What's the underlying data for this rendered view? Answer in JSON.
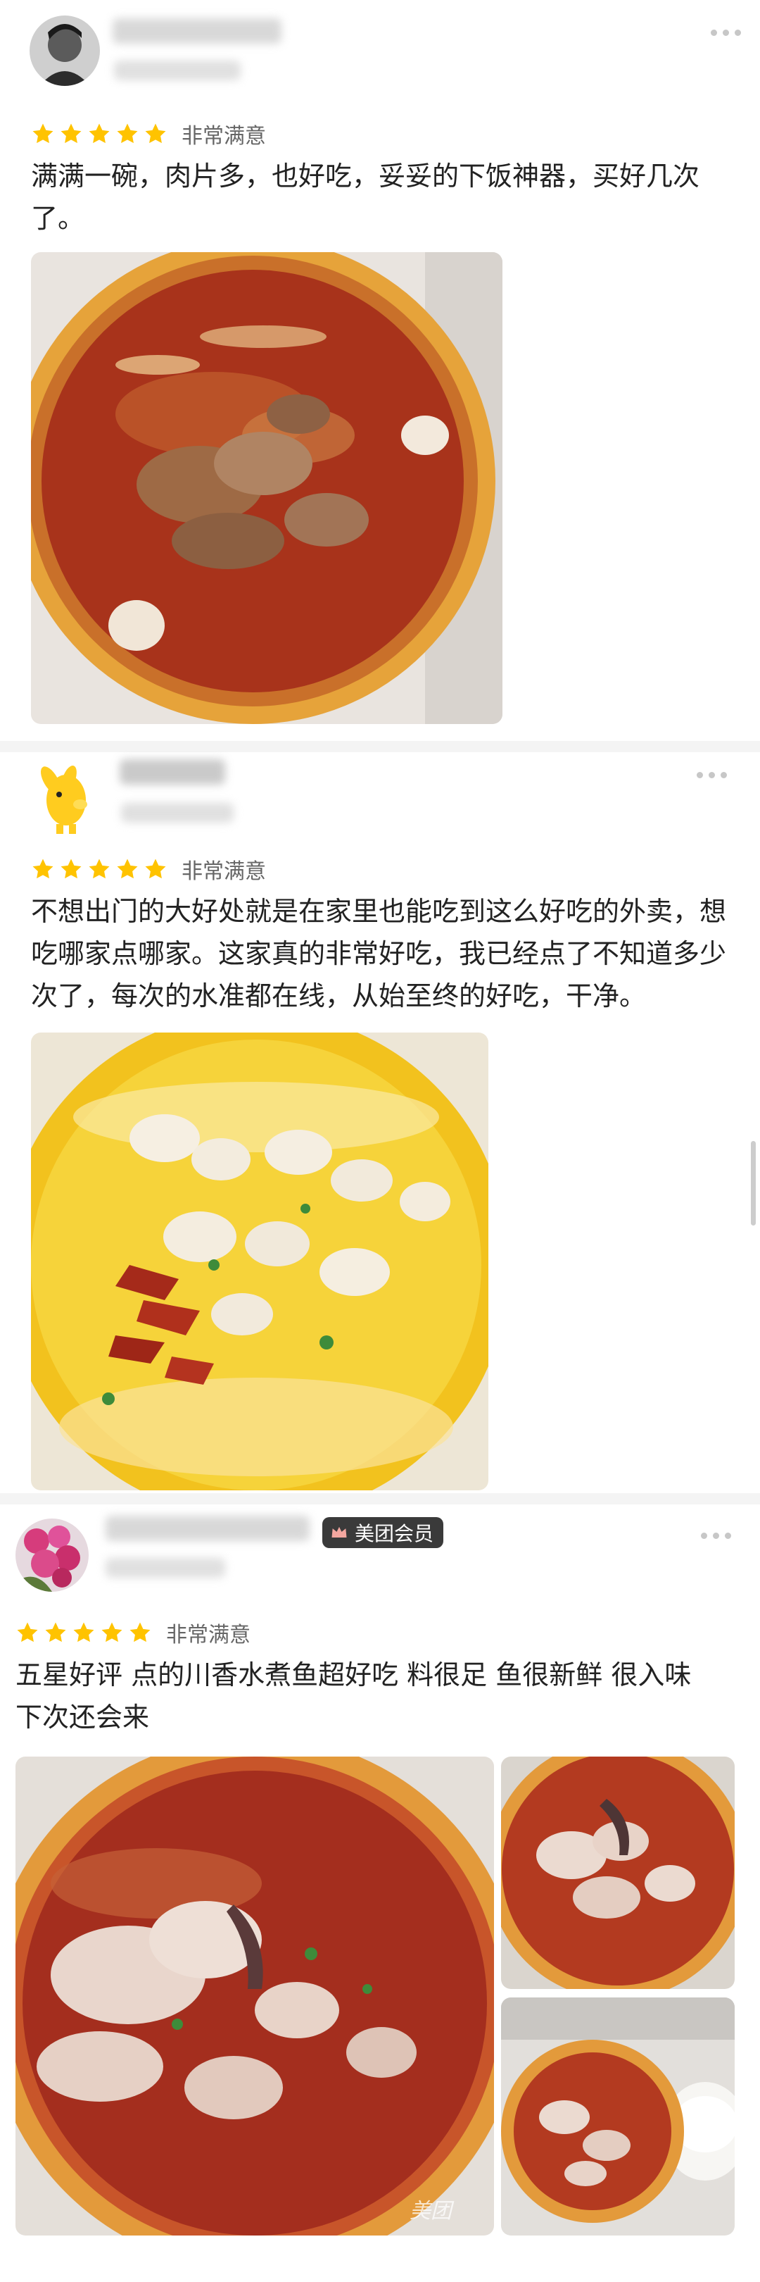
{
  "reviews": [
    {
      "rating_label": "非常满意",
      "stars": 5,
      "comment": "满满一碗，肉片多，也好吃，妥妥的下饭神器，买好几次了。",
      "photos": [
        "sour-soup-meat-bowl-photo"
      ]
    },
    {
      "rating_label": "非常满意",
      "stars": 5,
      "comment": "不想出门的大好处就是在家里也能吃到这么好吃的外卖，想吃哪家点哪家。这家真的非常好吃，我已经点了不知道多少次了，每次的水准都在线，从始至终的好吃，干净。",
      "photos": [
        "golden-soup-fish-photo"
      ]
    },
    {
      "rating_label": "非常满意",
      "stars": 5,
      "member_badge": "美团会员",
      "comment": "五星好评  点的川香水煮鱼超好吃 料很足  鱼很新鲜   很入味  下次还会来",
      "photos": [
        "boiled-fish-main-photo",
        "boiled-fish-side-photo-1",
        "boiled-fish-side-photo-2"
      ],
      "watermark": "美团"
    }
  ],
  "colors": {
    "star": "#FFC300",
    "badge_bg": "#3a3a3a",
    "badge_icon": "#F4A7A0"
  }
}
